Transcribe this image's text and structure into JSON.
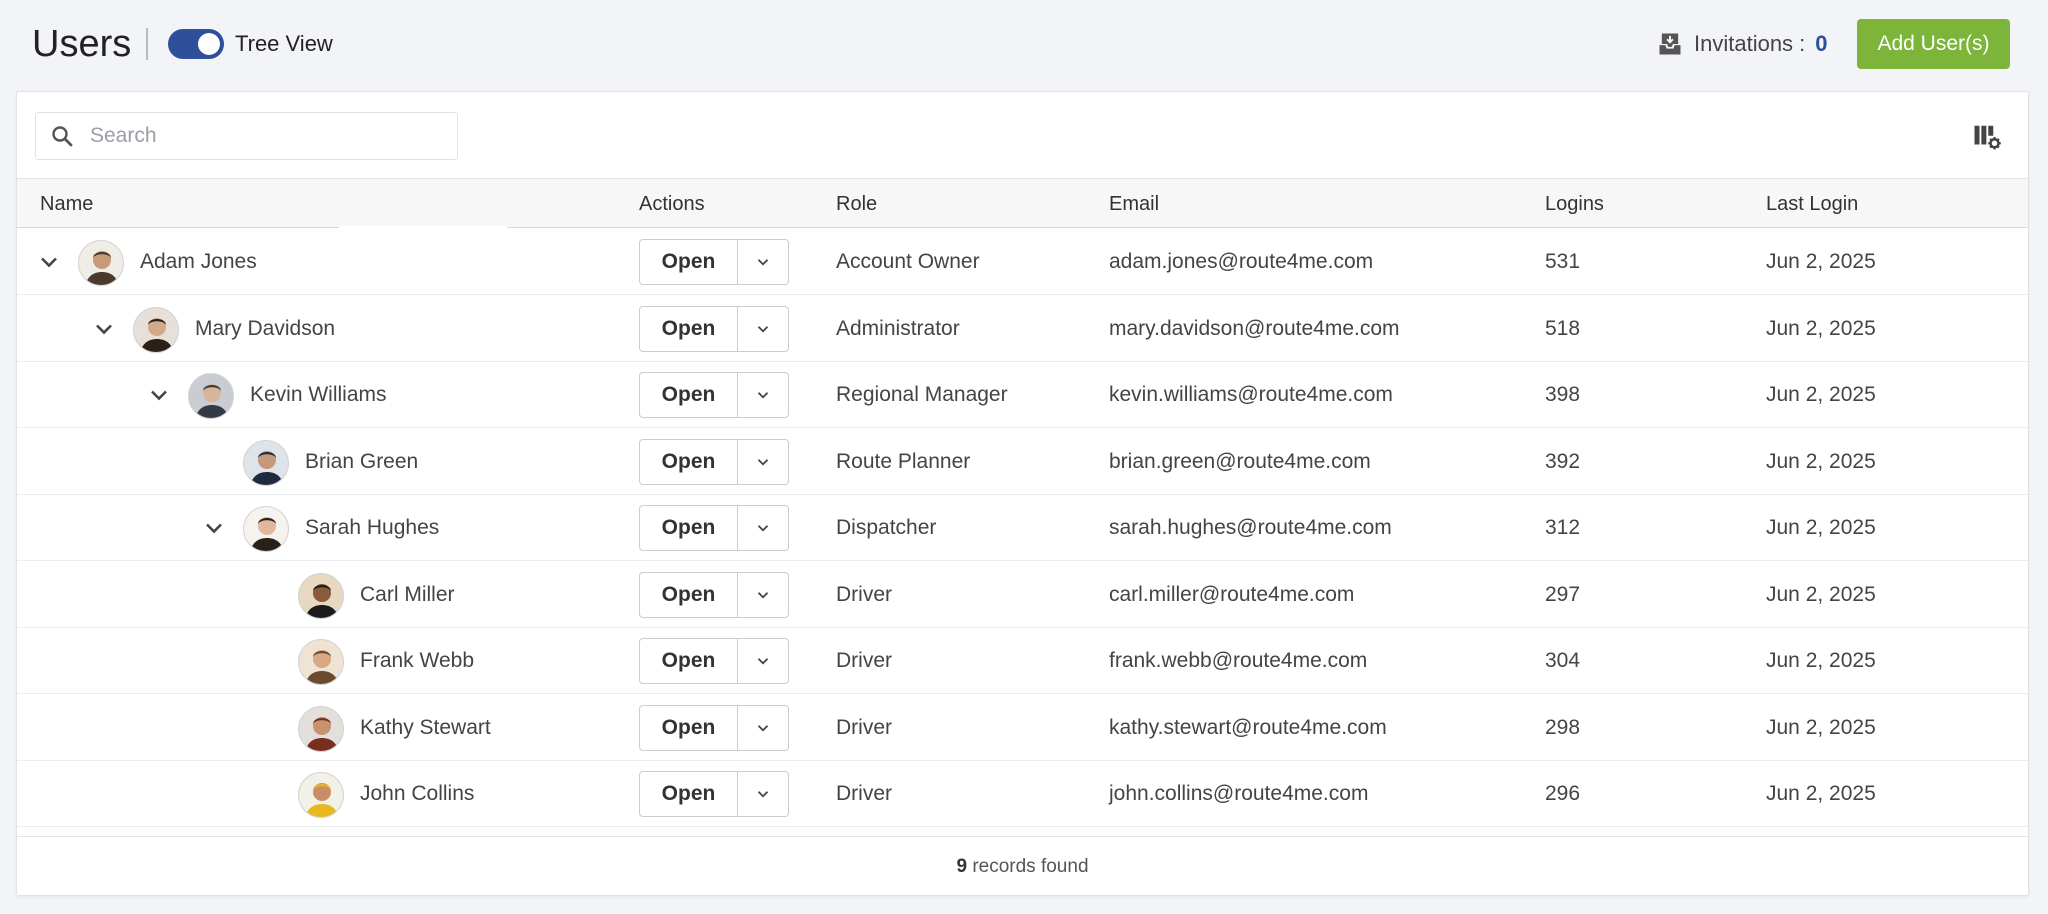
{
  "header": {
    "title": "Users",
    "tree_view_label": "Tree View",
    "tree_view_on": true,
    "invitations_label": "Invitations :",
    "invitations_count": "0",
    "add_button_label": "Add User(s)"
  },
  "search": {
    "placeholder": "Search",
    "value": ""
  },
  "table": {
    "columns": [
      "Name",
      "Actions",
      "Role",
      "Email",
      "Logins",
      "Last Login"
    ],
    "open_label": "Open",
    "rows": [
      {
        "name": "Adam Jones",
        "role": "Account Owner",
        "email": "adam.jones@route4me.com",
        "logins": "531",
        "last_login": "Jun 2, 2025"
      },
      {
        "name": "Mary Davidson",
        "role": "Administrator",
        "email": "mary.davidson@route4me.com",
        "logins": "518",
        "last_login": "Jun 2, 2025"
      },
      {
        "name": "Kevin Williams",
        "role": "Regional Manager",
        "email": "kevin.williams@route4me.com",
        "logins": "398",
        "last_login": "Jun 2, 2025"
      },
      {
        "name": "Brian Green",
        "role": "Route Planner",
        "email": "brian.green@route4me.com",
        "logins": "392",
        "last_login": "Jun 2, 2025"
      },
      {
        "name": "Sarah Hughes",
        "role": "Dispatcher",
        "email": "sarah.hughes@route4me.com",
        "logins": "312",
        "last_login": "Jun 2, 2025"
      },
      {
        "name": "Carl Miller",
        "role": "Driver",
        "email": "carl.miller@route4me.com",
        "logins": "297",
        "last_login": "Jun 2, 2025"
      },
      {
        "name": "Frank Webb",
        "role": "Driver",
        "email": "frank.webb@route4me.com",
        "logins": "304",
        "last_login": "Jun 2, 2025"
      },
      {
        "name": "Kathy Stewart",
        "role": "Driver",
        "email": "kathy.stewart@route4me.com",
        "logins": "298",
        "last_login": "Jun 2, 2025"
      },
      {
        "name": "John Collins",
        "role": "Driver",
        "email": "john.collins@route4me.com",
        "logins": "296",
        "last_login": "Jun 2, 2025"
      }
    ]
  },
  "footer": {
    "count": "9",
    "suffix": "records found"
  },
  "colors": {
    "accent_blue": "#2e4f9a",
    "add_green": "#7cb53a"
  },
  "icons": {
    "invitations": "inbox-download-icon",
    "columns": "column-settings-icon",
    "search": "search-icon",
    "expand": "chevron-down-icon"
  }
}
